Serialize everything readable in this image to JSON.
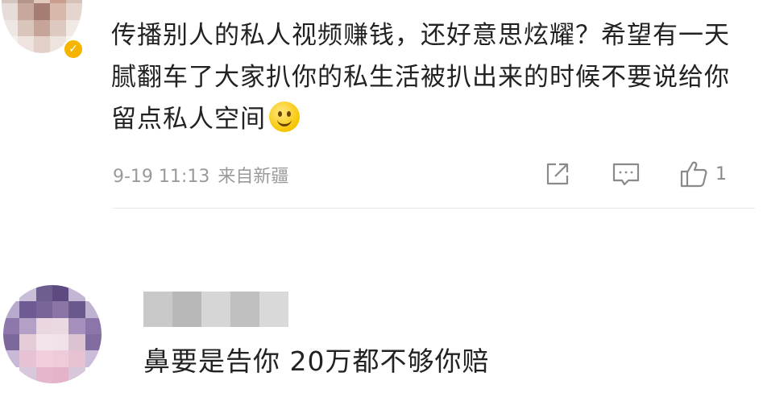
{
  "comments": [
    {
      "avatar_blurred": true,
      "verified": true,
      "text": "传播别人的私人视频赚钱，还好意思炫耀？希望有一天腻翻车了大家扒你的私生活被扒出来的时候不要说给你留点私人空间",
      "emoji": "smile-emoji",
      "time": "9-19 11:13",
      "location": "来自新疆",
      "actions": {
        "share_icon": "share-icon",
        "reply_icon": "comment-icon",
        "like_icon": "thumbs-up-icon",
        "like_count": "1"
      }
    },
    {
      "avatar_blurred": true,
      "username_blurred": true,
      "text": "鼻要是告你 20万都不够你赔"
    }
  ],
  "colors": {
    "text": "#222222",
    "meta": "#9a9a9a",
    "divider": "#e8e8e8",
    "verified_badge": "#f4b400"
  }
}
